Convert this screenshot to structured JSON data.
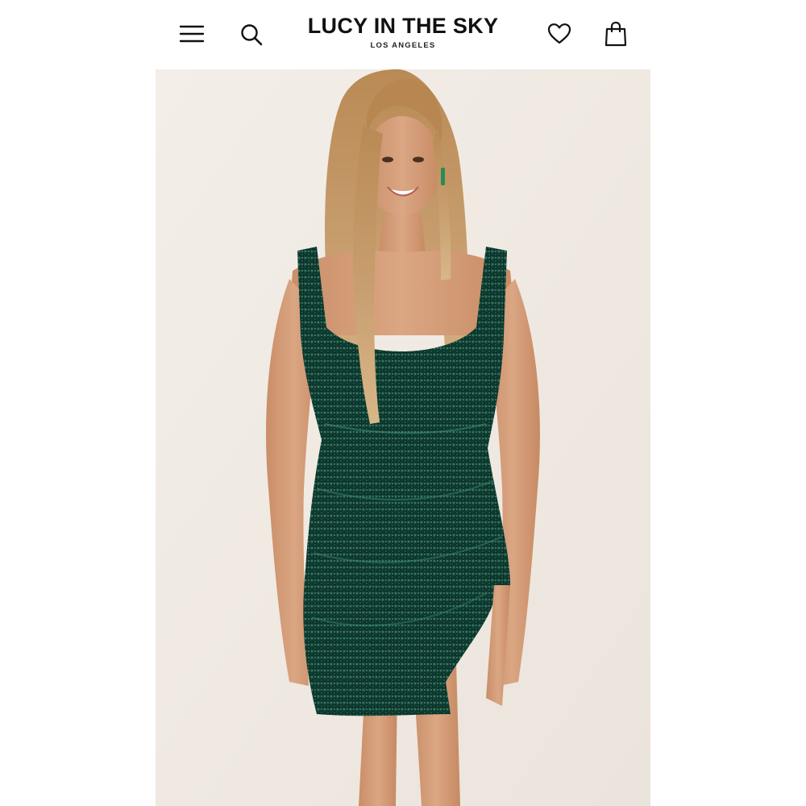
{
  "header": {
    "brand_name": "LUCY IN THE SKY",
    "brand_subtitle": "LOS ANGELES",
    "icons": {
      "menu": "hamburger-menu-icon",
      "search": "search-icon",
      "wishlist": "heart-icon",
      "cart": "shopping-bag-icon"
    }
  },
  "colors": {
    "header_background": "#ffffff",
    "brand_text": "#111111",
    "icon_stroke": "#111111",
    "photo_backdrop": "#f1ece6",
    "dress": "#0f3a30"
  }
}
